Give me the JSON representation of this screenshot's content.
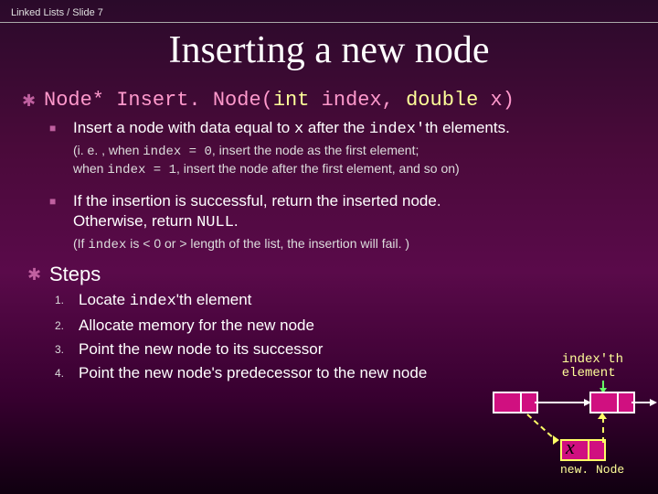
{
  "breadcrumb": "Linked Lists / Slide 7",
  "title": "Inserting a new node",
  "signature": {
    "ret": "Node*",
    "fname": "Insert. Node(",
    "kw1": "int",
    "arg1": " index, ",
    "kw2": "double",
    "arg2": " x)"
  },
  "bullet1": {
    "pre": "Insert a node with data equal to ",
    "x": "x",
    "mid": " after the ",
    "idx": "index'",
    "post": "th  elements."
  },
  "sub1_line1_a": "(i. e. , when ",
  "sub1_line1_b": "index = 0",
  "sub1_line1_c": ", insert the node as the first element;",
  "sub1_line2_a": "when ",
  "sub1_line2_b": "index = 1",
  "sub1_line2_c": ", insert the node after the first element, and so on)",
  "bullet2_line1": "If the insertion is successful, return the inserted node.",
  "bullet2_line2_a": " Otherwise, return ",
  "bullet2_line2_b": "NULL",
  "bullet2_line2_c": ".",
  "sub2_a": "(If ",
  "sub2_b": "index",
  "sub2_c": " is < 0 or > length of the list, the insertion will fail. )",
  "steps_header": "Steps",
  "steps": {
    "1": {
      "n": "1.",
      "a": "Locate ",
      "b": "index",
      "c": "'th element"
    },
    "2": {
      "n": "2.",
      "t": "Allocate memory for the new node"
    },
    "3": {
      "n": "3.",
      "t": "Point the new node to its successor"
    },
    "4": {
      "n": "4.",
      "t": "Point the new node's predecessor to the new node"
    }
  },
  "diagram": {
    "index_label_l1": "index'th",
    "index_label_l2": "element",
    "x": "x",
    "newnode": "new. Node"
  }
}
